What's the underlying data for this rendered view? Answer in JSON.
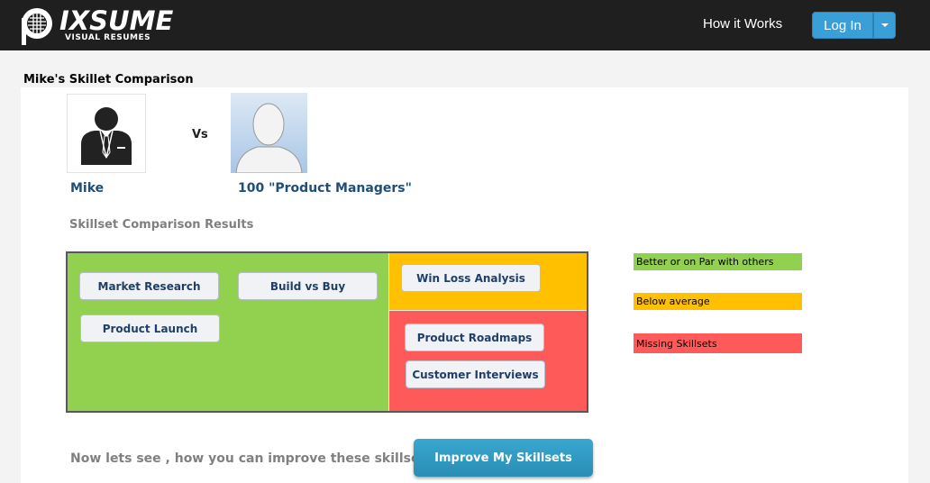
{
  "header": {
    "logo_main": "IXSUME",
    "logo_letter": "P",
    "logo_sub": "VISUAL RESUMES",
    "nav_how_it_works": "How it Works",
    "login_label": "Log In"
  },
  "page": {
    "title": "Mike's Skillet Comparison"
  },
  "comparison": {
    "user_name": "Mike",
    "vs_label": "Vs",
    "peer_label": "100 \"Product Managers\"",
    "section_title": "Skillset Comparison Results"
  },
  "skills": {
    "better": [
      "Market Research",
      "Build vs Buy",
      "Product Launch"
    ],
    "below": [
      "Win Loss Analysis"
    ],
    "missing": [
      "Product Roadmaps",
      "Customer Interviews"
    ]
  },
  "colors": {
    "better": "#92d050",
    "below": "#ffc000",
    "missing": "#ff5a5a"
  },
  "legend": {
    "better": "Better or on Par with others",
    "below": "Below average",
    "missing": "Missing Skillsets"
  },
  "footer": {
    "prompt": "Now lets see , how you can improve these skillsets",
    "improve_button": "Improve My Skillsets"
  }
}
